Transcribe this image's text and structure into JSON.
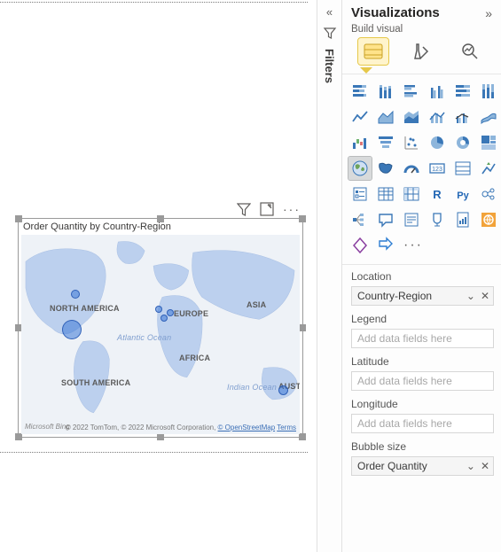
{
  "panel": {
    "title": "Visualizations",
    "subtitle": "Build visual",
    "collapse_icon": "»",
    "modes": {
      "fields_icon": "fields",
      "format_icon": "format",
      "analytics_icon": "analytics"
    }
  },
  "filters_rail": {
    "expand_icon": "«",
    "label": "Filters"
  },
  "visual": {
    "title": "Order Quantity by Country-Region",
    "filter_icon": "filter",
    "focus_icon": "focus-mode",
    "more_icon": "more",
    "map": {
      "labels": {
        "north_america": "NORTH AMERICA",
        "south_america": "SOUTH AMERICA",
        "europe": "EUROPE",
        "africa": "AFRICA",
        "asia": "ASIA",
        "australia": "AUSTR",
        "atlantic_ocean": "Atlantic Ocean",
        "indian_ocean": "Indian Ocean"
      },
      "bing_logo": "Microsoft Bing",
      "copyright_prefix": "© 2022 TomTom, © 2022 Microsoft Corporation,",
      "copyright_link1": "© OpenStreetMap",
      "copyright_link2": "Terms"
    }
  },
  "viz_icons": {
    "row1": [
      "stacked-bar",
      "stacked-column",
      "clustered-bar",
      "clustered-column",
      "hundred-bar",
      "hundred-column"
    ],
    "row2": [
      "line",
      "area",
      "stacked-area",
      "line-stacked-col",
      "line-clustered-col",
      "ribbon"
    ],
    "row3": [
      "waterfall",
      "funnel",
      "scatter",
      "pie",
      "donut",
      "treemap"
    ],
    "row4": [
      "map",
      "filled-map",
      "azure-map",
      "gauge",
      "card",
      "multi-row-card"
    ],
    "row5": [
      "kpi",
      "slicer",
      "table",
      "matrix",
      "r-visual",
      "py-visual"
    ],
    "row6_a": "key-influencers",
    "row6_b": "decomposition-tree",
    "row6_c": "qa",
    "row6_d": "smart-narrative",
    "row6_e": "paginated",
    "row6_f": "arcgis",
    "row7_a": "powerapps",
    "row7_b": "power-automate",
    "more": "···"
  },
  "wells": {
    "location": {
      "label": "Location",
      "value": "Country-Region"
    },
    "legend": {
      "label": "Legend",
      "placeholder": "Add data fields here"
    },
    "latitude": {
      "label": "Latitude",
      "placeholder": "Add data fields here"
    },
    "longitude": {
      "label": "Longitude",
      "placeholder": "Add data fields here"
    },
    "bubble": {
      "label": "Bubble size",
      "value": "Order Quantity"
    }
  }
}
